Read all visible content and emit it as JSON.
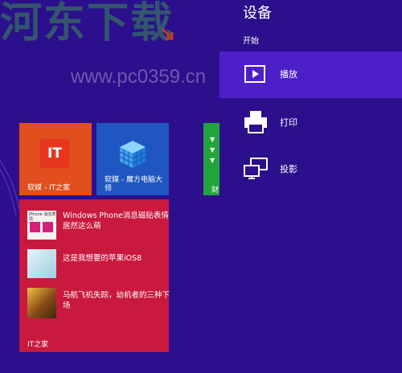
{
  "watermark": {
    "text": "河东下载",
    "url": "www.pc0359.cn"
  },
  "start": {
    "tiles": [
      {
        "id": "ithome",
        "label": "软媒 - IT之家",
        "logo_text": "IT",
        "color": "#e04f1d"
      },
      {
        "id": "cube",
        "label": "软媒 - 魔方电脑大师",
        "color": "#1f56c2"
      },
      {
        "id": "green",
        "label": "财",
        "color": "#23a43a"
      }
    ],
    "news": {
      "items": [
        {
          "title": "Windows Phone消息磁贴表情居然这么萌",
          "thumb_caption": "iPhone 消息表情"
        },
        {
          "title": "这是我想要的苹果iOS8"
        },
        {
          "title": "马航飞机失踪，幼机者的三种下场"
        }
      ],
      "source": "IT之家",
      "color": "#c9193e"
    }
  },
  "charm": {
    "title": "设备",
    "section": "开始",
    "items": [
      {
        "label": "播放",
        "icon": "play-icon",
        "selected": true
      },
      {
        "label": "打印",
        "icon": "printer-icon",
        "selected": false
      },
      {
        "label": "投影",
        "icon": "projector-icon",
        "selected": false
      }
    ]
  }
}
